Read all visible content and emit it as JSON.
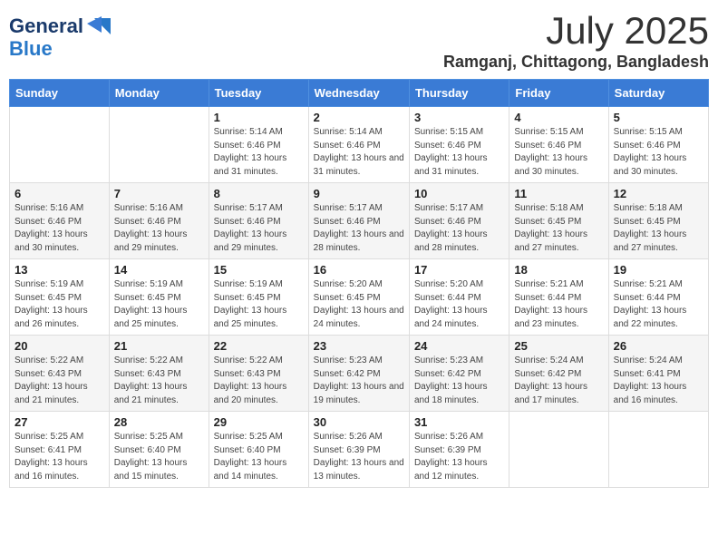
{
  "logo": {
    "line1": "General",
    "line2": "Blue"
  },
  "header": {
    "month": "July 2025",
    "location": "Ramganj, Chittagong, Bangladesh"
  },
  "weekdays": [
    "Sunday",
    "Monday",
    "Tuesday",
    "Wednesday",
    "Thursday",
    "Friday",
    "Saturday"
  ],
  "weeks": [
    [
      {
        "day": "",
        "info": ""
      },
      {
        "day": "",
        "info": ""
      },
      {
        "day": "1",
        "info": "Sunrise: 5:14 AM\nSunset: 6:46 PM\nDaylight: 13 hours and 31 minutes."
      },
      {
        "day": "2",
        "info": "Sunrise: 5:14 AM\nSunset: 6:46 PM\nDaylight: 13 hours and 31 minutes."
      },
      {
        "day": "3",
        "info": "Sunrise: 5:15 AM\nSunset: 6:46 PM\nDaylight: 13 hours and 31 minutes."
      },
      {
        "day": "4",
        "info": "Sunrise: 5:15 AM\nSunset: 6:46 PM\nDaylight: 13 hours and 30 minutes."
      },
      {
        "day": "5",
        "info": "Sunrise: 5:15 AM\nSunset: 6:46 PM\nDaylight: 13 hours and 30 minutes."
      }
    ],
    [
      {
        "day": "6",
        "info": "Sunrise: 5:16 AM\nSunset: 6:46 PM\nDaylight: 13 hours and 30 minutes."
      },
      {
        "day": "7",
        "info": "Sunrise: 5:16 AM\nSunset: 6:46 PM\nDaylight: 13 hours and 29 minutes."
      },
      {
        "day": "8",
        "info": "Sunrise: 5:17 AM\nSunset: 6:46 PM\nDaylight: 13 hours and 29 minutes."
      },
      {
        "day": "9",
        "info": "Sunrise: 5:17 AM\nSunset: 6:46 PM\nDaylight: 13 hours and 28 minutes."
      },
      {
        "day": "10",
        "info": "Sunrise: 5:17 AM\nSunset: 6:46 PM\nDaylight: 13 hours and 28 minutes."
      },
      {
        "day": "11",
        "info": "Sunrise: 5:18 AM\nSunset: 6:45 PM\nDaylight: 13 hours and 27 minutes."
      },
      {
        "day": "12",
        "info": "Sunrise: 5:18 AM\nSunset: 6:45 PM\nDaylight: 13 hours and 27 minutes."
      }
    ],
    [
      {
        "day": "13",
        "info": "Sunrise: 5:19 AM\nSunset: 6:45 PM\nDaylight: 13 hours and 26 minutes."
      },
      {
        "day": "14",
        "info": "Sunrise: 5:19 AM\nSunset: 6:45 PM\nDaylight: 13 hours and 25 minutes."
      },
      {
        "day": "15",
        "info": "Sunrise: 5:19 AM\nSunset: 6:45 PM\nDaylight: 13 hours and 25 minutes."
      },
      {
        "day": "16",
        "info": "Sunrise: 5:20 AM\nSunset: 6:45 PM\nDaylight: 13 hours and 24 minutes."
      },
      {
        "day": "17",
        "info": "Sunrise: 5:20 AM\nSunset: 6:44 PM\nDaylight: 13 hours and 24 minutes."
      },
      {
        "day": "18",
        "info": "Sunrise: 5:21 AM\nSunset: 6:44 PM\nDaylight: 13 hours and 23 minutes."
      },
      {
        "day": "19",
        "info": "Sunrise: 5:21 AM\nSunset: 6:44 PM\nDaylight: 13 hours and 22 minutes."
      }
    ],
    [
      {
        "day": "20",
        "info": "Sunrise: 5:22 AM\nSunset: 6:43 PM\nDaylight: 13 hours and 21 minutes."
      },
      {
        "day": "21",
        "info": "Sunrise: 5:22 AM\nSunset: 6:43 PM\nDaylight: 13 hours and 21 minutes."
      },
      {
        "day": "22",
        "info": "Sunrise: 5:22 AM\nSunset: 6:43 PM\nDaylight: 13 hours and 20 minutes."
      },
      {
        "day": "23",
        "info": "Sunrise: 5:23 AM\nSunset: 6:42 PM\nDaylight: 13 hours and 19 minutes."
      },
      {
        "day": "24",
        "info": "Sunrise: 5:23 AM\nSunset: 6:42 PM\nDaylight: 13 hours and 18 minutes."
      },
      {
        "day": "25",
        "info": "Sunrise: 5:24 AM\nSunset: 6:42 PM\nDaylight: 13 hours and 17 minutes."
      },
      {
        "day": "26",
        "info": "Sunrise: 5:24 AM\nSunset: 6:41 PM\nDaylight: 13 hours and 16 minutes."
      }
    ],
    [
      {
        "day": "27",
        "info": "Sunrise: 5:25 AM\nSunset: 6:41 PM\nDaylight: 13 hours and 16 minutes."
      },
      {
        "day": "28",
        "info": "Sunrise: 5:25 AM\nSunset: 6:40 PM\nDaylight: 13 hours and 15 minutes."
      },
      {
        "day": "29",
        "info": "Sunrise: 5:25 AM\nSunset: 6:40 PM\nDaylight: 13 hours and 14 minutes."
      },
      {
        "day": "30",
        "info": "Sunrise: 5:26 AM\nSunset: 6:39 PM\nDaylight: 13 hours and 13 minutes."
      },
      {
        "day": "31",
        "info": "Sunrise: 5:26 AM\nSunset: 6:39 PM\nDaylight: 13 hours and 12 minutes."
      },
      {
        "day": "",
        "info": ""
      },
      {
        "day": "",
        "info": ""
      }
    ]
  ]
}
